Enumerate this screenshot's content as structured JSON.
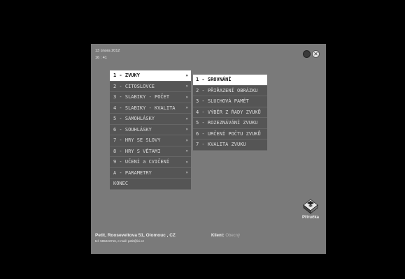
{
  "header": {
    "date": "13 února 2012",
    "time": "16 : 41"
  },
  "main_menu": {
    "items": [
      {
        "label": "1 - ZVUKY",
        "arrow": "»"
      },
      {
        "label": "2 - CITOSLOVCE",
        "arrow": "»"
      },
      {
        "label": "3 - SLABIKY - POČET",
        "arrow": "»"
      },
      {
        "label": "4 - SLABIKY - KVALITA",
        "arrow": "»"
      },
      {
        "label": "5 - SAMOHLÁSKY",
        "arrow": "»"
      },
      {
        "label": "6 - SOUHLÁSKY",
        "arrow": "»"
      },
      {
        "label": "7 - HRY SE SLOVY",
        "arrow": "»"
      },
      {
        "label": "8 - HRY S VĚTAMI",
        "arrow": "»"
      },
      {
        "label": "9 - UČENÍ a CVIČENÍ",
        "arrow": "»"
      },
      {
        "label": "A - PARAMETRY",
        "arrow": "»"
      },
      {
        "label": "KONEC",
        "arrow": ""
      }
    ]
  },
  "submenu": {
    "items": [
      {
        "label": "1 - SROVNÁNÍ"
      },
      {
        "label": "2 - PŘIŘAZENÍ OBRÁZKU"
      },
      {
        "label": "3 - SLUCHOVÁ PAMĚT"
      },
      {
        "label": "4 - VÝBĚR Z ŘADY ZVUKŮ"
      },
      {
        "label": "5 - ROZEZNÁVÁNÍ ZVUKU"
      },
      {
        "label": "6 - URČENÍ POČTU ZVUKŮ"
      },
      {
        "label": "7 - KVALITA ZVUKU"
      }
    ]
  },
  "footer": {
    "address": "Petit, Rooseveltova 51, Olomouc , CZ",
    "contact": "tel: 585223716, e-mail: petit@ici.cz",
    "client_label": "Klient:",
    "client_value": "Obecný"
  },
  "manual": {
    "label": "Příručka",
    "icon": "manual-book-icon"
  }
}
